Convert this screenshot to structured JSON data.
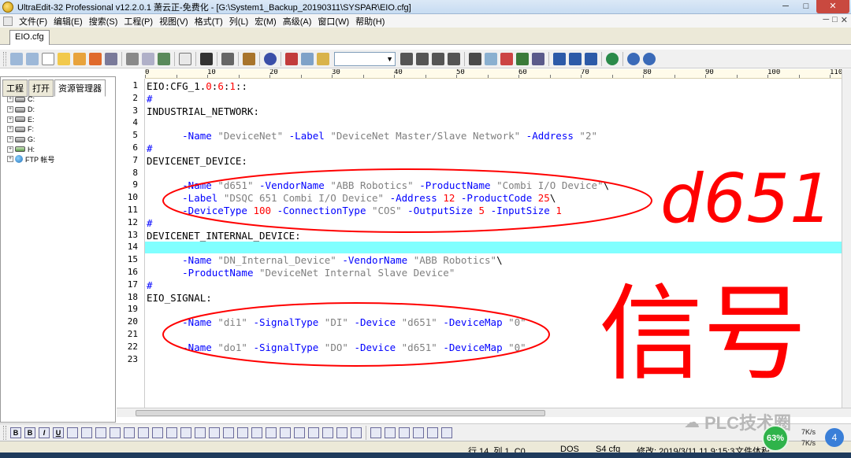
{
  "window": {
    "title": "UltraEdit-32 Professional v12.2.0.1 萧云正-免费化 - [G:\\System1_Backup_20190311\\SYSPAR\\EIO.cfg]",
    "btn_min": "─",
    "btn_max": "□",
    "btn_close": "✕"
  },
  "menu": {
    "items": [
      "文件(F)",
      "编辑(E)",
      "搜索(S)",
      "工程(P)",
      "视图(V)",
      "格式(T)",
      "列(L)",
      "宏(M)",
      "高级(A)",
      "窗口(W)",
      "帮助(H)"
    ],
    "right_controls": [
      "─",
      "□",
      "✕"
    ]
  },
  "file_tab": "EIO.cfg",
  "left_panel": {
    "tabs": [
      "工程",
      "打开",
      "资源管理器"
    ],
    "tree": [
      {
        "label": "C:",
        "icon": "drive-icon"
      },
      {
        "label": "D:",
        "icon": "drive-icon"
      },
      {
        "label": "E:",
        "icon": "drive-icon"
      },
      {
        "label": "F:",
        "icon": "drive-icon"
      },
      {
        "label": "G:",
        "icon": "drive-icon"
      },
      {
        "label": "H:",
        "icon": "network-drive-icon"
      },
      {
        "label": "FTP 帐号",
        "icon": "globe-icon"
      }
    ]
  },
  "ruler": {
    "labels": [
      "0",
      "10",
      "20",
      "30",
      "40",
      "50",
      "60",
      "70",
      "80",
      "90",
      "100",
      "110"
    ]
  },
  "editor": {
    "highlighted_line": 14,
    "lines": [
      {
        "n": "1",
        "tokens": [
          {
            "t": "EIO:CFG_1.",
            "c": "plain"
          },
          {
            "t": "0",
            "c": "num"
          },
          {
            "t": ":",
            "c": "plain"
          },
          {
            "t": "6",
            "c": "num"
          },
          {
            "t": ":",
            "c": "plain"
          },
          {
            "t": "1",
            "c": "num"
          },
          {
            "t": "::",
            "c": "plain"
          }
        ]
      },
      {
        "n": "2",
        "tokens": [
          {
            "t": "#",
            "c": "kw"
          }
        ]
      },
      {
        "n": "3",
        "tokens": [
          {
            "t": "INDUSTRIAL_NETWORK:",
            "c": "plain"
          }
        ]
      },
      {
        "n": "4",
        "tokens": []
      },
      {
        "n": "5",
        "tokens": [
          {
            "t": "      ",
            "c": "plain"
          },
          {
            "t": "-Name",
            "c": "kw"
          },
          {
            "t": " \"DeviceNet\" ",
            "c": "str"
          },
          {
            "t": "-Label",
            "c": "kw"
          },
          {
            "t": " \"DeviceNet Master/Slave Network\" ",
            "c": "str"
          },
          {
            "t": "-Address",
            "c": "kw"
          },
          {
            "t": " \"2\"",
            "c": "str"
          }
        ]
      },
      {
        "n": "6",
        "tokens": [
          {
            "t": "#",
            "c": "kw"
          }
        ]
      },
      {
        "n": "7",
        "tokens": [
          {
            "t": "DEVICENET_DEVICE:",
            "c": "plain"
          }
        ]
      },
      {
        "n": "8",
        "tokens": []
      },
      {
        "n": "9",
        "tokens": [
          {
            "t": "      ",
            "c": "plain"
          },
          {
            "t": "-Name",
            "c": "kw"
          },
          {
            "t": " \"d651\" ",
            "c": "str"
          },
          {
            "t": "-VendorName",
            "c": "kw"
          },
          {
            "t": " \"ABB Robotics\" ",
            "c": "str"
          },
          {
            "t": "-ProductName",
            "c": "kw"
          },
          {
            "t": " \"Combi I/O Device\"",
            "c": "str"
          },
          {
            "t": "\\",
            "c": "plain"
          }
        ]
      },
      {
        "n": "10",
        "tokens": [
          {
            "t": "      ",
            "c": "plain"
          },
          {
            "t": "-Label",
            "c": "kw"
          },
          {
            "t": " \"DSQC 651 Combi I/O Device\" ",
            "c": "str"
          },
          {
            "t": "-Address",
            "c": "kw"
          },
          {
            "t": " ",
            "c": "plain"
          },
          {
            "t": "12",
            "c": "num"
          },
          {
            "t": " ",
            "c": "plain"
          },
          {
            "t": "-ProductCode",
            "c": "kw"
          },
          {
            "t": " ",
            "c": "plain"
          },
          {
            "t": "25",
            "c": "num"
          },
          {
            "t": "\\",
            "c": "plain"
          }
        ]
      },
      {
        "n": "11",
        "tokens": [
          {
            "t": "      ",
            "c": "plain"
          },
          {
            "t": "-DeviceType",
            "c": "kw"
          },
          {
            "t": " ",
            "c": "plain"
          },
          {
            "t": "100",
            "c": "num"
          },
          {
            "t": " ",
            "c": "plain"
          },
          {
            "t": "-ConnectionType",
            "c": "kw"
          },
          {
            "t": " \"COS\" ",
            "c": "str"
          },
          {
            "t": "-OutputSize",
            "c": "kw"
          },
          {
            "t": " ",
            "c": "plain"
          },
          {
            "t": "5",
            "c": "num"
          },
          {
            "t": " ",
            "c": "plain"
          },
          {
            "t": "-InputSize",
            "c": "kw"
          },
          {
            "t": " ",
            "c": "plain"
          },
          {
            "t": "1",
            "c": "num"
          }
        ]
      },
      {
        "n": "12",
        "tokens": [
          {
            "t": "#",
            "c": "kw"
          }
        ]
      },
      {
        "n": "13",
        "tokens": [
          {
            "t": "DEVICENET_INTERNAL_DEVICE:",
            "c": "plain"
          }
        ]
      },
      {
        "n": "14",
        "tokens": []
      },
      {
        "n": "15",
        "tokens": [
          {
            "t": "      ",
            "c": "plain"
          },
          {
            "t": "-Name",
            "c": "kw"
          },
          {
            "t": " \"DN_Internal_Device\" ",
            "c": "str"
          },
          {
            "t": "-VendorName",
            "c": "kw"
          },
          {
            "t": " \"ABB Robotics\"",
            "c": "str"
          },
          {
            "t": "\\",
            "c": "plain"
          }
        ]
      },
      {
        "n": "16",
        "tokens": [
          {
            "t": "      ",
            "c": "plain"
          },
          {
            "t": "-ProductName",
            "c": "kw"
          },
          {
            "t": " \"DeviceNet Internal Slave Device\"",
            "c": "str"
          }
        ]
      },
      {
        "n": "17",
        "tokens": [
          {
            "t": "#",
            "c": "kw"
          }
        ]
      },
      {
        "n": "18",
        "tokens": [
          {
            "t": "EIO_SIGNAL:",
            "c": "plain"
          }
        ]
      },
      {
        "n": "19",
        "tokens": []
      },
      {
        "n": "20",
        "tokens": [
          {
            "t": "      ",
            "c": "plain"
          },
          {
            "t": "-Name",
            "c": "kw"
          },
          {
            "t": " \"di1\" ",
            "c": "str"
          },
          {
            "t": "-SignalType",
            "c": "kw"
          },
          {
            "t": " \"DI\" ",
            "c": "str"
          },
          {
            "t": "-Device",
            "c": "kw"
          },
          {
            "t": " \"d651\" ",
            "c": "str"
          },
          {
            "t": "-DeviceMap",
            "c": "kw"
          },
          {
            "t": " \"0\"",
            "c": "str"
          }
        ]
      },
      {
        "n": "21",
        "tokens": []
      },
      {
        "n": "22",
        "tokens": [
          {
            "t": "      ",
            "c": "plain"
          },
          {
            "t": "-Name",
            "c": "kw"
          },
          {
            "t": " \"do1\" ",
            "c": "str"
          },
          {
            "t": "-SignalType",
            "c": "kw"
          },
          {
            "t": " \"DO\" ",
            "c": "str"
          },
          {
            "t": "-Device",
            "c": "kw"
          },
          {
            "t": " \"d651\" ",
            "c": "str"
          },
          {
            "t": "-DeviceMap",
            "c": "kw"
          },
          {
            "t": " \"0\"",
            "c": "str"
          }
        ]
      },
      {
        "n": "23",
        "tokens": []
      }
    ]
  },
  "annotations": {
    "label_device": "d651",
    "label_signal": "信号",
    "color": "#ff0000"
  },
  "status": {
    "position": "行 14, 列 1, C0",
    "line_ending": "DOS",
    "codepage": "S4 cfg",
    "modified": "修改: 2019/3/11 11 9:15:3",
    "file_size": "文件体积"
  },
  "watermark": "PLC技术圈",
  "net_widget": {
    "percent": "63%",
    "up": "7K/s",
    "down": "7K/s",
    "badge": "4"
  },
  "colors": {
    "keyword": "#0000ff",
    "string": "#808080",
    "number": "#ff0000",
    "highlight": "#80ffff"
  }
}
